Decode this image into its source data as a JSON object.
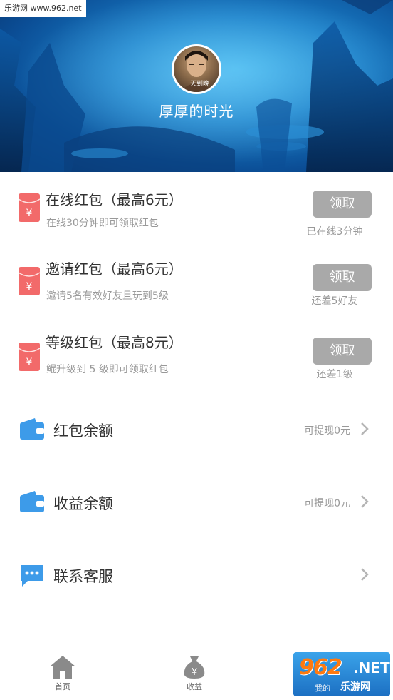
{
  "watermark": {
    "top_text": "乐游网 www.962.net",
    "logo": "962",
    "net": ".NET",
    "sub": "乐游网",
    "partial_tab": "我的"
  },
  "profile": {
    "avatar_caption": "一天到晚",
    "username": "厚厚的时光"
  },
  "colors": {
    "packet_red": "#f26a6a",
    "menu_blue": "#3d9be9",
    "button_gray": "#a9a9a9",
    "header_blue": "#1a7fc8"
  },
  "red_packets": [
    {
      "title": "在线红包（最高6元）",
      "desc": "在线30分钟即可领取红包",
      "button": "领取",
      "status": "已在线3分钟",
      "icon": "red-packet-icon"
    },
    {
      "title": "邀请红包（最高6元）",
      "desc": "邀请5名有效好友且玩到5级",
      "button": "领取",
      "status": "还差5好友",
      "icon": "red-packet-icon"
    },
    {
      "title": "等级红包（最高8元）",
      "desc": "鲲升级到  5 级即可领取红包",
      "button": "领取",
      "status": "还差1级",
      "icon": "red-packet-icon"
    }
  ],
  "menu": [
    {
      "label": "红包余额",
      "value": "可提现0元",
      "icon": "wallet-icon"
    },
    {
      "label": "收益余额",
      "value": "可提现0元",
      "icon": "wallet-icon"
    },
    {
      "label": "联系客服",
      "value": "",
      "icon": "chat-bubble-icon"
    }
  ],
  "nav": [
    {
      "label": "首页",
      "icon": "home-icon"
    },
    {
      "label": "收益",
      "icon": "money-bag-icon"
    },
    {
      "label": "我的",
      "icon": "user-icon"
    }
  ]
}
